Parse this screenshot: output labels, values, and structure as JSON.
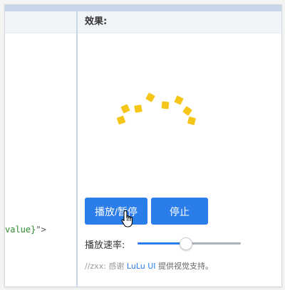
{
  "code": {
    "snippet_value": "value}",
    "snippet_rest": "\">"
  },
  "effect": {
    "header": "效果:"
  },
  "buttons": {
    "play_pause": "播放/暂停",
    "stop": "停止"
  },
  "speed": {
    "label": "播放速率:",
    "value_fraction": 0.46
  },
  "credit": {
    "prefix": "//zxx: 感谢 ",
    "link": "LuLu UI",
    "suffix": " 提供视觉支持。"
  },
  "colors": {
    "accent": "#2b7de9",
    "dot": "#f5c518",
    "header_bar": "#c8d5e8"
  },
  "icons": {
    "cursor": "hand-pointer-icon"
  }
}
